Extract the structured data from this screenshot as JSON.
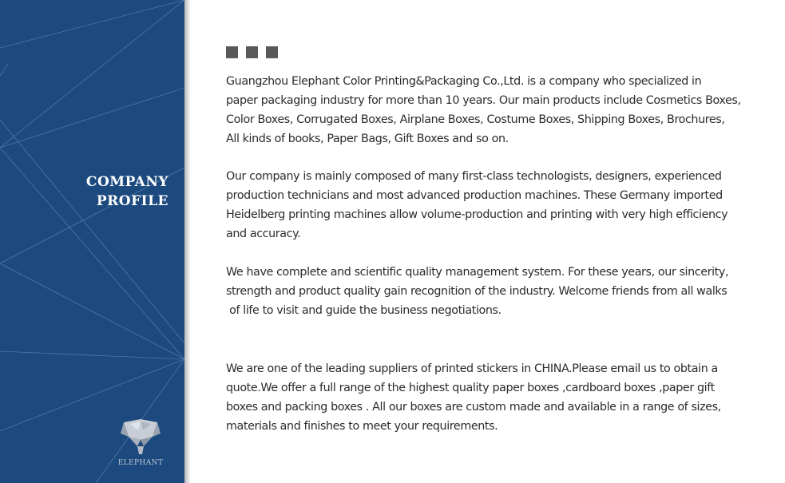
{
  "sidebar": {
    "background_color": "#1c4a7e",
    "title_line1": "COMPANY",
    "title_line2": "PROFILE",
    "logo": {
      "icon": "elephant-icon",
      "text": "ELEPHANT"
    }
  },
  "decoration": {
    "square_count": 3,
    "square_color": "#595959"
  },
  "paragraphs": [
    {
      "lines": [
        "Guangzhou Elephant Color Printing&Packaging Co.,Ltd. is a company who specialized in",
        "paper packaging industry for more than 10 years. Our main products include Cosmetics Boxes,",
        "Color Boxes, Corrugated Boxes, Airplane Boxes, Costume Boxes, Shipping Boxes, Brochures,",
        "All kinds of books, Paper Bags, Gift Boxes and so on."
      ]
    },
    {
      "lines": [
        "Our company is mainly composed of many first-class technologists, designers, experienced",
        "production technicians and most advanced production machines. These Germany imported",
        "Heidelberg printing machines allow volume-production and printing with very high efficiency",
        "and accuracy."
      ]
    },
    {
      "lines": [
        "We have complete and scientific quality management system. For these years, our sincerity,",
        "strength and product quality gain recognition of the industry. Welcome friends from all walks",
        " of life to visit and guide the business negotiations."
      ]
    },
    {
      "lines": [
        "We are one of the leading suppliers of printed stickers in CHINA.Please email us to obtain a",
        "quote.We offer a full range of the highest quality paper boxes ,cardboard boxes ,paper gift",
        "boxes and packing boxes . All our boxes are custom made and available in a range of sizes,",
        "materials and finishes to meet your requirements."
      ]
    }
  ]
}
